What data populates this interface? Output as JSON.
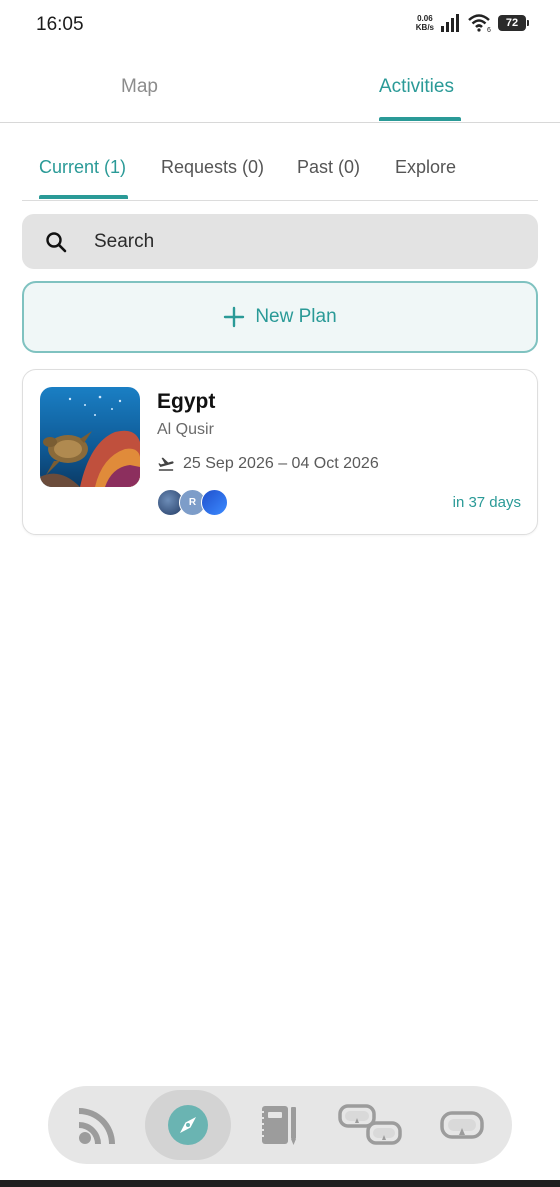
{
  "status_bar": {
    "time": "16:05",
    "net_speed_value": "0.06",
    "net_speed_unit": "KB/s",
    "battery": "72"
  },
  "top_tabs": [
    {
      "label": "Map",
      "active": false
    },
    {
      "label": "Activities",
      "active": true
    }
  ],
  "sub_tabs": [
    {
      "label": "Current (1)",
      "active": true
    },
    {
      "label": "Requests (0)",
      "active": false
    },
    {
      "label": "Past (0)",
      "active": false
    },
    {
      "label": "Explore",
      "active": false
    }
  ],
  "search": {
    "placeholder": "Search",
    "value": "",
    "icon": "search-icon"
  },
  "new_plan": {
    "label": "New Plan",
    "icon": "plus-icon"
  },
  "plans": [
    {
      "title": "Egypt",
      "location": "Al Qusir",
      "dates": "25 Sep 2026 – 04 Oct 2026",
      "countdown": "in 37 days",
      "avatar_initial": "R"
    }
  ],
  "bottom_nav": [
    {
      "icon": "feed-icon",
      "active": false
    },
    {
      "icon": "compass-icon",
      "active": true
    },
    {
      "icon": "logbook-icon",
      "active": false
    },
    {
      "icon": "buddies-mask-icon",
      "active": false
    },
    {
      "icon": "dive-mask-icon",
      "active": false
    }
  ],
  "colors": {
    "accent": "#2a9a97",
    "nav_bg": "#e6e6e6",
    "search_bg": "#e3e3e3"
  }
}
